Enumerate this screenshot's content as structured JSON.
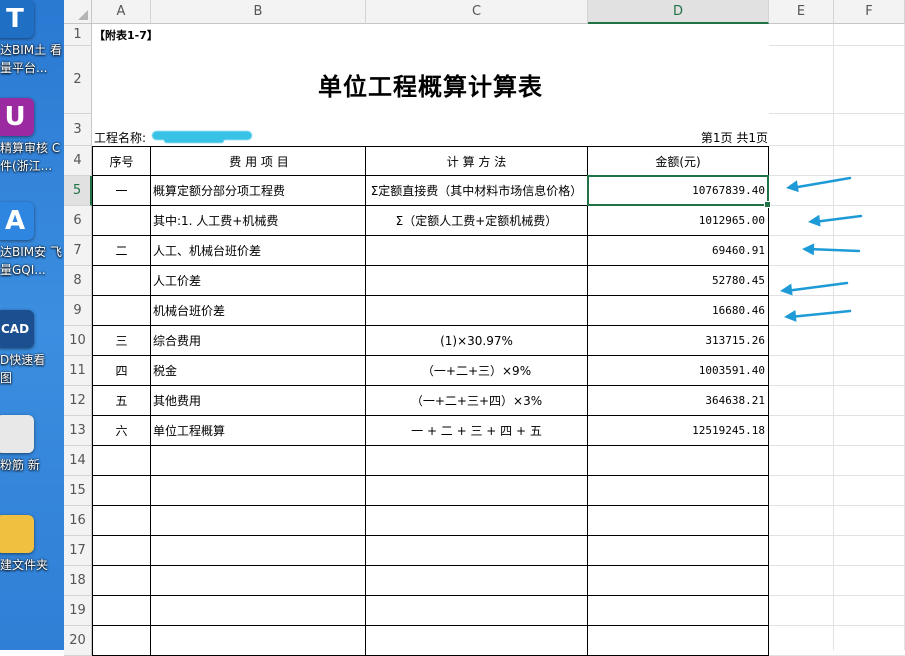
{
  "desktop": {
    "icons": [
      {
        "name": "glodon-bim-civil",
        "lines": [
          "达BIM土 看",
          "量平台..."
        ],
        "tile": "#1f6fc5",
        "glyph": "T"
      },
      {
        "name": "glodon-audit",
        "lines": [
          "精算审核 C",
          "件(浙江..."
        ],
        "tile": "#9b2aa0",
        "glyph": "U"
      },
      {
        "name": "glodon-bim-install",
        "lines": [
          "达BIM安 飞",
          "量GQI..."
        ],
        "tile": "#2f86e0",
        "glyph": "A"
      },
      {
        "name": "cad-viewer",
        "lines": [
          "D快速看",
          "图"
        ],
        "tile": "#1b4f8f",
        "glyph": "CAD"
      },
      {
        "name": "document",
        "lines": [
          "粉筋  新"
        ],
        "tile": "#e8e8e8",
        "glyph": ""
      },
      {
        "name": "new-folder",
        "lines": [
          "建文件夹"
        ],
        "tile": "#f0c040",
        "glyph": ""
      }
    ]
  },
  "sheet": {
    "columns": [
      "A",
      "B",
      "C",
      "D",
      "E",
      "F"
    ],
    "selected_column": "D",
    "rows": [
      "1",
      "2",
      "3",
      "4",
      "5",
      "6",
      "7",
      "8",
      "9",
      "10",
      "11",
      "12",
      "13",
      "14",
      "15",
      "16",
      "17",
      "18",
      "19",
      "20"
    ],
    "selected_row": "5",
    "note": "【附表1-7】",
    "title": "单位工程概算计算表",
    "project_label": "工程名称:",
    "page_info": "第1页 共1页",
    "header": {
      "seq": "序号",
      "item": "费 用 项 目",
      "method": "计 算 方 法",
      "amount": "金额(元)"
    },
    "body": [
      {
        "seq": "一",
        "item": "概算定额分部分项工程费",
        "method": "Σ定额直接费（其中材料市场信息价格）",
        "amount": "10767839.40"
      },
      {
        "seq": "",
        "item": "其中:1. 人工费+机械费",
        "method": "Σ（定额人工费+定额机械费）",
        "amount": "1012965.00"
      },
      {
        "seq": "二",
        "item": "人工、机械台班价差",
        "method": "",
        "amount": "69460.91"
      },
      {
        "seq": "",
        "item": "人工价差",
        "method": "",
        "amount": "52780.45"
      },
      {
        "seq": "",
        "item": "机械台班价差",
        "method": "",
        "amount": "16680.46"
      },
      {
        "seq": "三",
        "item": "综合费用",
        "method": "(1)×30.97%",
        "amount": "313715.26"
      },
      {
        "seq": "四",
        "item": "税金",
        "method": "（一+二+三）×9%",
        "amount": "1003591.40"
      },
      {
        "seq": "五",
        "item": "其他费用",
        "method": "（一+二+三+四）×3%",
        "amount": "364638.21"
      },
      {
        "seq": "六",
        "item": "单位工程概算",
        "method": "一 + 二 + 三 + 四 + 五",
        "amount": "12519245.18"
      }
    ],
    "annotation_color": "#1e9bd7",
    "selection_color": "#217346"
  }
}
